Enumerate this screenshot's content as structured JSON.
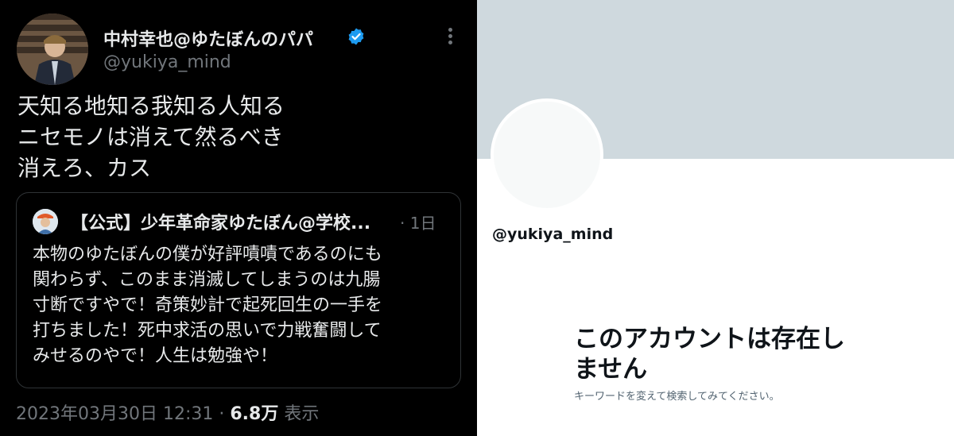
{
  "tweet": {
    "display_name": "中村幸也@ゆたぼんのパパ",
    "handle": "@yukiya_mind",
    "body_lines": [
      "天知る地知る我知る人知る",
      "ニセモノは消えて然るべき",
      "消えろ、カス"
    ],
    "quote": {
      "name": "【公式】少年革命家ゆたぼん@学校...",
      "time": "· 1日",
      "body_lines": [
        "本物のゆたぼんの僕が好評嘖嘖であるのにも",
        "関わらず、このまま消滅してしまうのは九腸",
        "寸断ですやで！奇策妙計で起死回生の一手を",
        "打ちました！死中求活の思いで力戦奮闘して",
        "みせるのやで！人生は勉強や！"
      ]
    },
    "timestamp": "2023年03月30日 12:31",
    "separator": " · ",
    "views_count": "6.8万",
    "views_label": " 表示",
    "icons": [
      "verified-badge-icon",
      "more-options-icon"
    ]
  },
  "profile": {
    "handle": "@yukiya_mind",
    "title_lines": [
      "このアカウントは存在し",
      "ません"
    ],
    "subtitle": "キーワードを変えて検索してみてください。"
  },
  "colors": {
    "dark_bg": "#000000",
    "text_primary_dark": "#e7e9ea",
    "text_secondary": "#71767b",
    "verified": "#1d9bf0",
    "banner": "#cfd9de",
    "light_text": "#0f1419",
    "light_secondary": "#536471"
  }
}
